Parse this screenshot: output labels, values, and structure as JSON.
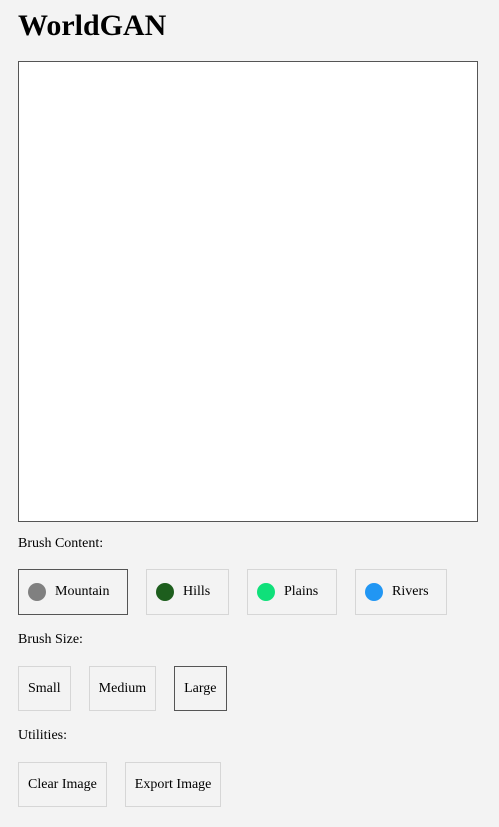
{
  "app": {
    "title": "WorldGAN"
  },
  "brush_content": {
    "label": "Brush Content:",
    "items": [
      {
        "label": "Mountain",
        "color": "#808080",
        "selected": true
      },
      {
        "label": "Hills",
        "color": "#1d5e1d",
        "selected": false
      },
      {
        "label": "Plains",
        "color": "#0fe07a",
        "selected": false
      },
      {
        "label": "Rivers",
        "color": "#2196f3",
        "selected": false
      }
    ]
  },
  "brush_size": {
    "label": "Brush Size:",
    "items": [
      {
        "label": "Small",
        "selected": false
      },
      {
        "label": "Medium",
        "selected": false
      },
      {
        "label": "Large",
        "selected": true
      }
    ]
  },
  "utilities": {
    "label": "Utilities:",
    "items": [
      {
        "label": "Clear Image"
      },
      {
        "label": "Export Image"
      }
    ]
  }
}
